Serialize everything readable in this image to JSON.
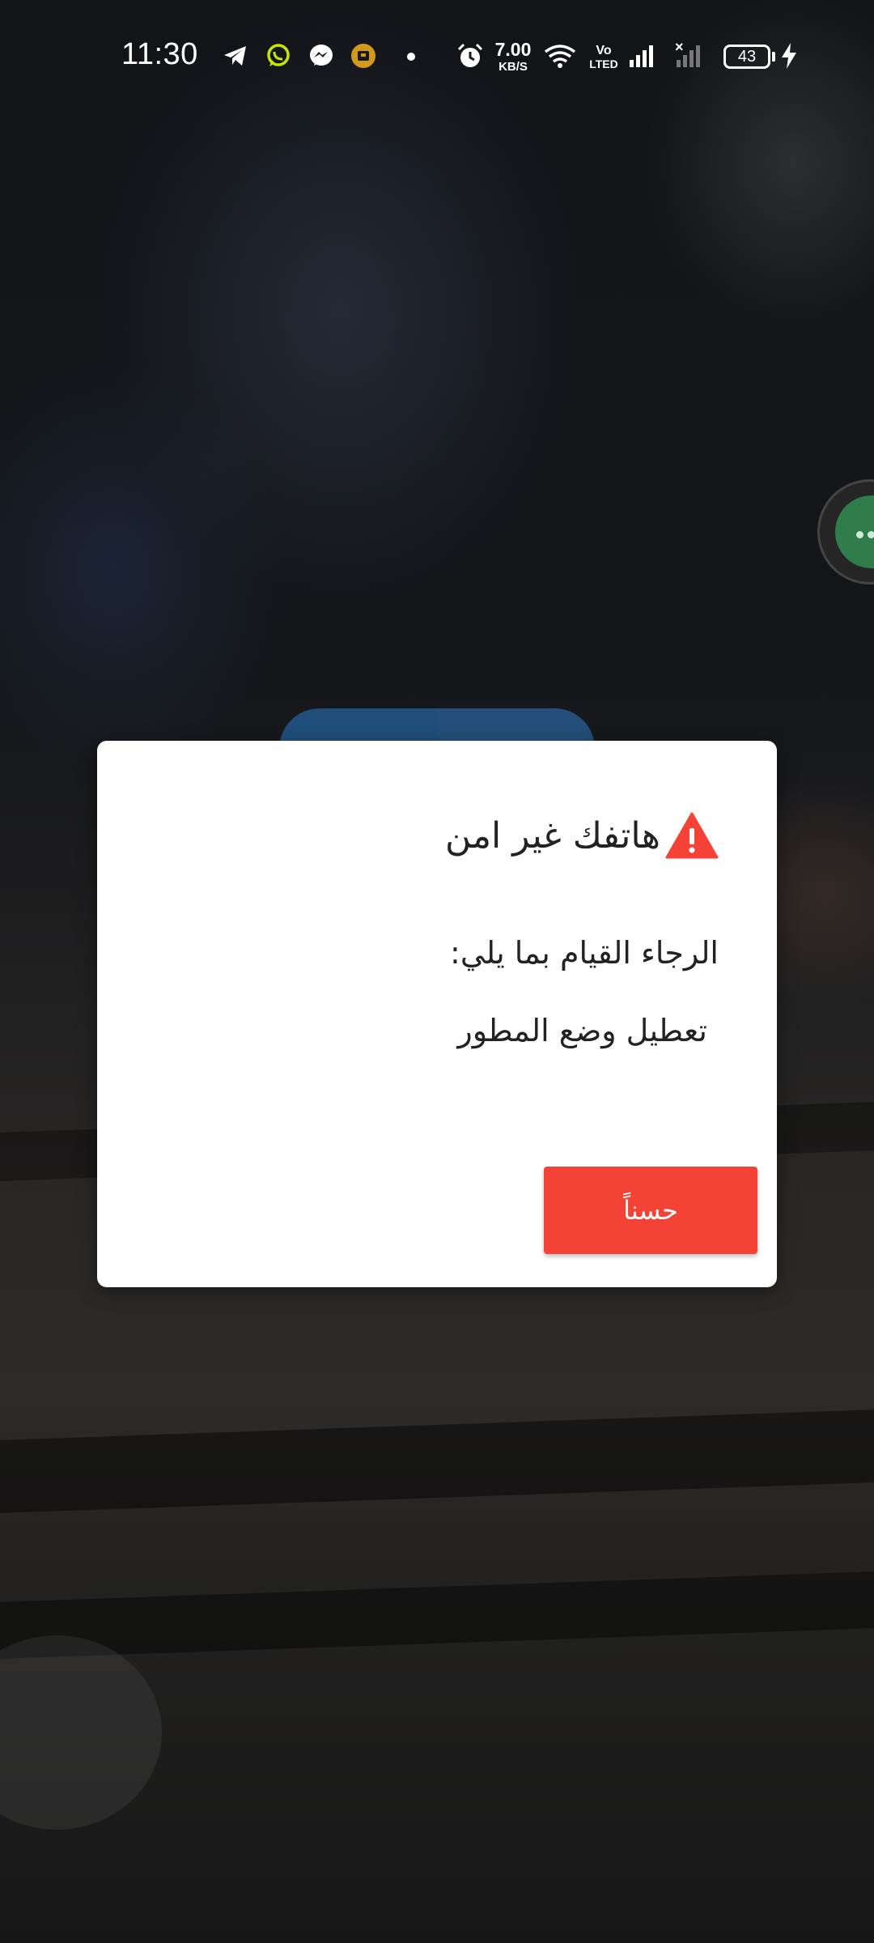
{
  "status_bar": {
    "time": "11:30",
    "net_speed_value": "7.00",
    "net_speed_unit": "KB/S",
    "volte_top": "Vo",
    "volte_bottom": "LTED",
    "sim2_mark": "×",
    "battery_level": "43",
    "notification_icons": [
      "telegram-icon",
      "whatsapp-icon",
      "messenger-icon",
      "app-notification-icon",
      "dot-icon"
    ],
    "system_icons": [
      "alarm-icon",
      "wifi-icon",
      "signal-icon",
      "signal-no-service-icon",
      "battery-icon",
      "charging-icon"
    ]
  },
  "dialog": {
    "title": "هاتفك غير امن",
    "icon": "warning-icon",
    "message_line1": "الرجاء القيام بما يلي:",
    "message_line2": "تعطيل وضع المطور",
    "ok_label": "حسناً",
    "accent_color": "#f44336"
  }
}
